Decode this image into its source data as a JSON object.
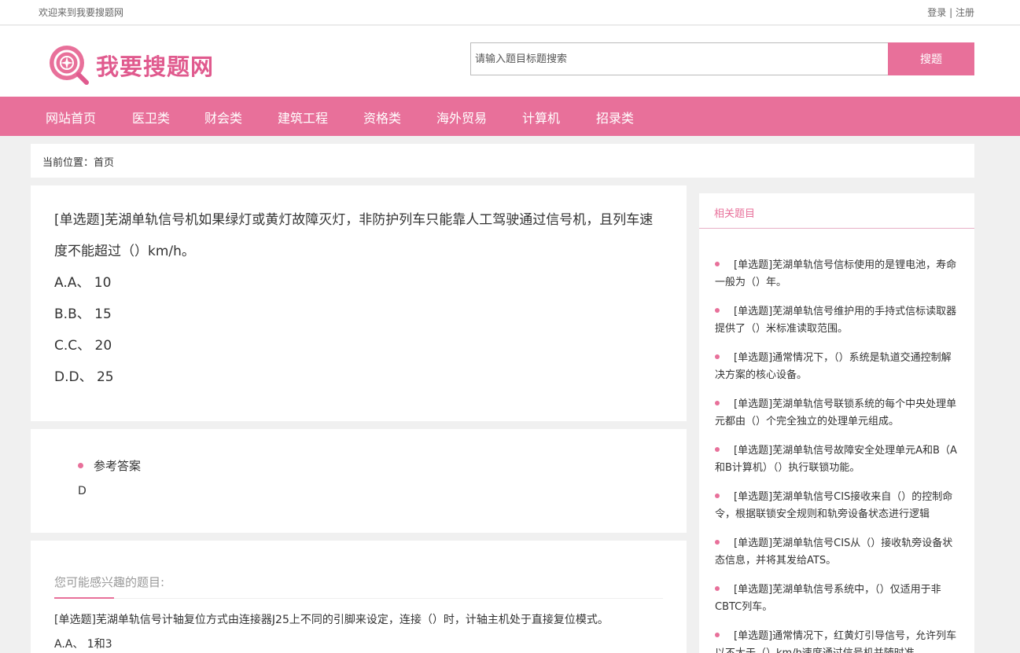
{
  "topbar": {
    "welcome": "欢迎来到我要搜题网",
    "login": "登录",
    "separator": " | ",
    "register": "注册"
  },
  "header": {
    "logo_text": "我要搜题网",
    "search_placeholder": "请输入题目标题搜索",
    "search_button": "搜题"
  },
  "nav": [
    {
      "label": "网站首页"
    },
    {
      "label": "医卫类"
    },
    {
      "label": "财会类"
    },
    {
      "label": "建筑工程"
    },
    {
      "label": "资格类"
    },
    {
      "label": "海外贸易"
    },
    {
      "label": "计算机"
    },
    {
      "label": "招录类"
    }
  ],
  "breadcrumb": {
    "label": "当前位置：",
    "current": "首页"
  },
  "question": {
    "title": "[单选题]芜湖单轨信号机如果绿灯或黄灯故障灭灯，非防护列车只能靠人工驾驶通过信号机，且列车速度不能超过（）km/h。",
    "options": [
      "A.A、 10",
      "B.B、 15",
      "C.C、 20",
      "D.D、 25"
    ]
  },
  "answer": {
    "label": "参考答案",
    "value": "D"
  },
  "more": {
    "title": "您可能感兴趣的题目:",
    "question": "[单选题]芜湖单轨信号计轴复位方式由连接器J25上不同的引脚来设定，连接（）时，计轴主机处于直接复位模式。",
    "option": "A.A、 1和3"
  },
  "related": {
    "title": "相关题目",
    "items": [
      "[单选题]芜湖单轨信号信标使用的是锂电池，寿命一般为（）年。",
      "[单选题]芜湖单轨信号维护用的手持式信标读取器提供了（）米标准读取范围。",
      "[单选题]通常情况下，（）系统是轨道交通控制解决方案的核心设备。",
      "[单选题]芜湖单轨信号联锁系统的每个中央处理单元都由（）个完全独立的处理单元组成。",
      "[单选题]芜湖单轨信号故障安全处理单元A和B（A和B计算机）（）执行联锁功能。",
      "[单选题]芜湖单轨信号CIS接收来自（）的控制命令，根据联锁安全规则和轨旁设备状态进行逻辑",
      "[单选题]芜湖单轨信号CIS从（）接收轨旁设备状态信息，并将其发给ATS。",
      "[单选题]芜湖单轨信号系统中，（）仅适用于非CBTC列车。",
      "[单选题]通常情况下，红黄灯引导信号，允许列车以不大于（）km/h速度通过信号机并随时准"
    ]
  },
  "colors": {
    "accent": "#e8709a",
    "logo": "#e05a8e"
  }
}
